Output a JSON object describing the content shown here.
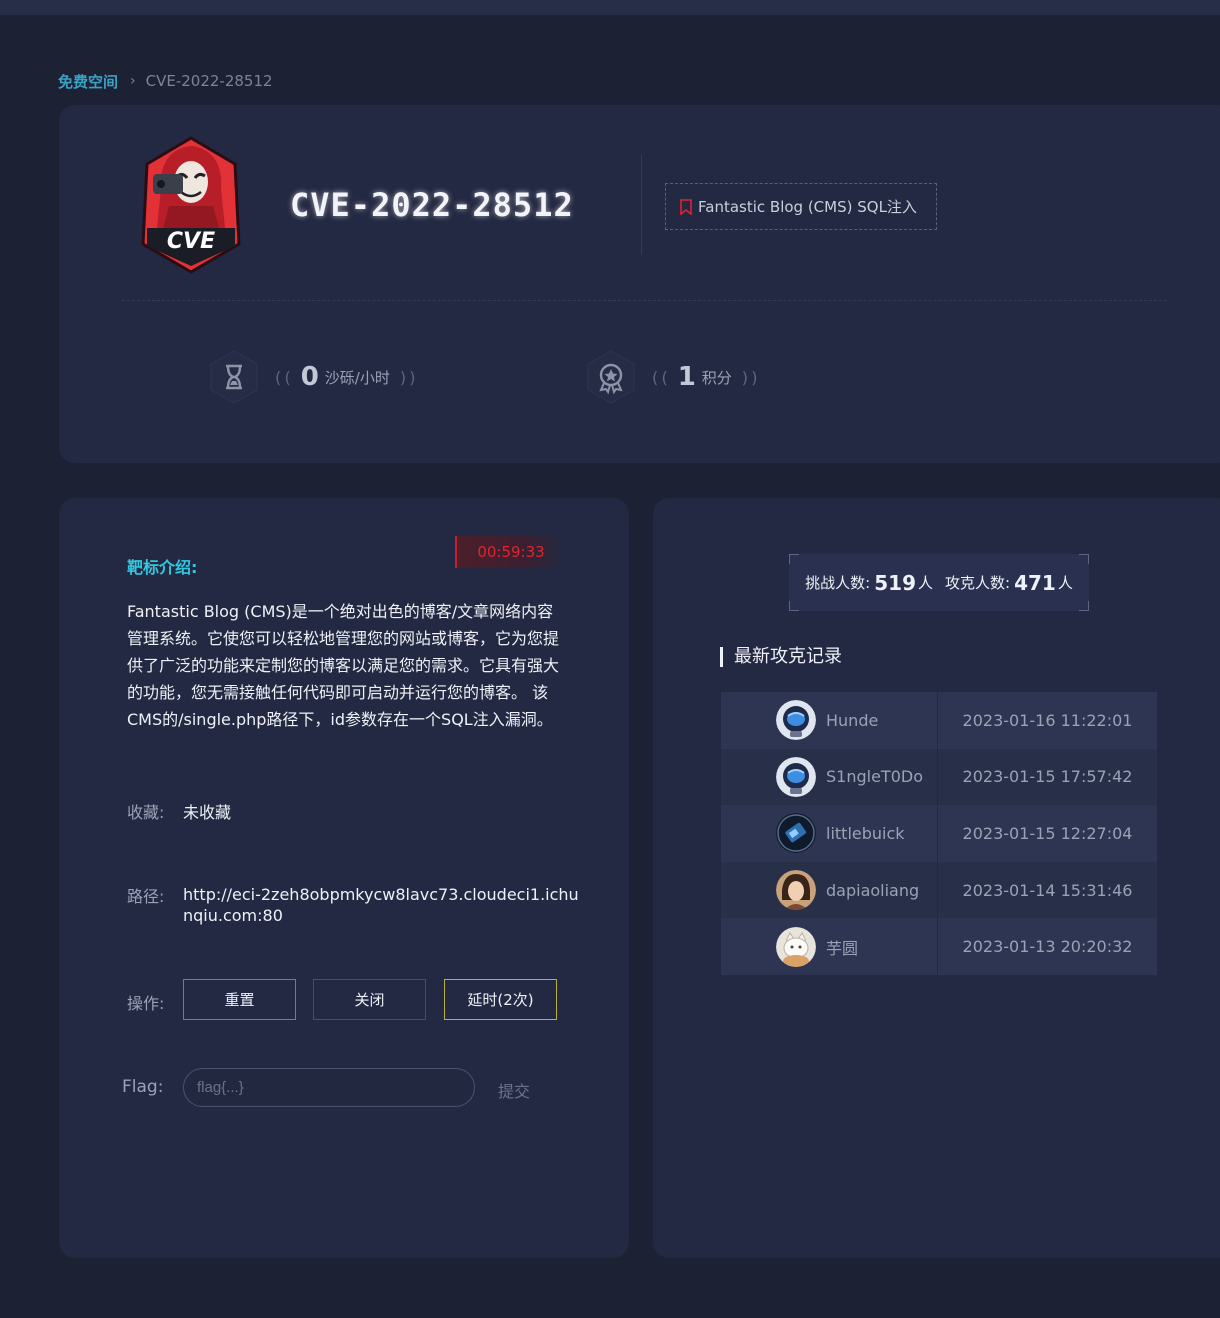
{
  "breadcrumb": {
    "root": "免费空间",
    "separator": ">",
    "current": "CVE-2022-28512"
  },
  "header": {
    "title": "CVE-2022-28512",
    "logo_text": "CVE",
    "tag": "Fantastic Blog (CMS) SQL注入",
    "stats": [
      {
        "icon": "hourglass-icon",
        "value": "0",
        "unit": "沙砾/小时"
      },
      {
        "icon": "medal-icon",
        "value": "1",
        "unit": "积分"
      }
    ]
  },
  "intro": {
    "label": "靶标介绍:",
    "timer": "00:59:33",
    "text": "Fantastic Blog (CMS)是一个绝对出色的博客/文章网络内容管理系统。它使您可以轻松地管理您的网站或博客，它为您提供了广泛的功能来定制您的博客以满足您的需求。它具有强大的功能，您无需接触任何代码即可启动并运行您的博客。 该CMS的/single.php路径下，id参数存在一个SQL注入漏洞。",
    "favorite_label": "收藏:",
    "favorite_value": "未收藏",
    "path_label": "路径:",
    "path_value": "http://eci-2zeh8obpmkycw8lavc73.cloudeci1.ichunqiu.com:80",
    "actions_label": "操作:",
    "actions": {
      "reset": "重置",
      "close": "关闭",
      "delay": "延时(2次)"
    },
    "flag_label": "Flag:",
    "flag_placeholder": "flag{...}",
    "submit": "提交"
  },
  "counter": {
    "challengers_label": "挑战人数:",
    "challengers": "519",
    "solvers_label": "攻克人数:",
    "solvers": "471",
    "unit": "人"
  },
  "records": {
    "title": "最新攻克记录",
    "rows": [
      {
        "user": "Hunde",
        "time": "2023-01-16 11:22:01",
        "avatar": "astronaut"
      },
      {
        "user": "S1ngleT0Do",
        "time": "2023-01-15 17:57:42",
        "avatar": "astronaut"
      },
      {
        "user": "littlebuick",
        "time": "2023-01-15 12:27:04",
        "avatar": "phone"
      },
      {
        "user": "dapiaoliang",
        "time": "2023-01-14 15:31:46",
        "avatar": "portrait"
      },
      {
        "user": "芋圆",
        "time": "2023-01-13 20:20:32",
        "avatar": "cat"
      }
    ]
  },
  "colors": {
    "background": "#1c2133",
    "card": "#232942",
    "accent_cyan": "#33c7e0",
    "timer_red": "#e0242d",
    "reset_border": "#2f8fd0",
    "close_border": "#b0232d",
    "delay_border": "#b7b23a"
  }
}
